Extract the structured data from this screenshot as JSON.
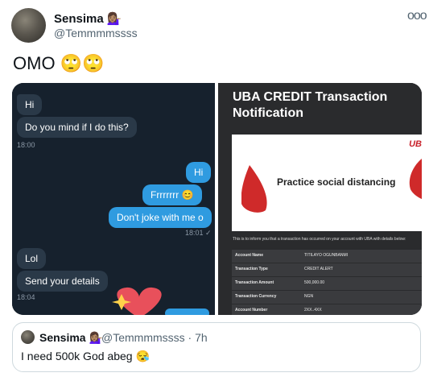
{
  "tweet": {
    "display_name": "Sensima",
    "name_emoji": "💁🏽‍♀️",
    "handle": "@Temmmmssss",
    "more_glyph": "ooo",
    "text": "OMO 🙄🙄"
  },
  "chat": {
    "messages": [
      {
        "dir": "in",
        "text": "Hi"
      },
      {
        "dir": "in",
        "text": "Do you mind if I do this?"
      },
      {
        "dir": "out",
        "text": "Hi"
      },
      {
        "dir": "out",
        "text": "Frrrrrrr 😊"
      },
      {
        "dir": "out",
        "text": "Don't joke with me o"
      },
      {
        "dir": "in",
        "text": "Lol"
      },
      {
        "dir": "in",
        "text": "Send your details"
      }
    ],
    "times": {
      "t1": "18:00",
      "t2": "18:01 ✓",
      "t3": "18:04"
    }
  },
  "uba": {
    "title": "UBA CREDIT Transaction Notification",
    "banner_text": "Practice social distancing",
    "banner_logo": "UB",
    "info_text": "This is to inform you that a transaction has occurred on your account with UBA with details below:",
    "rows": [
      {
        "label": "Account Name",
        "value": "TITILAYO OGUNBANMI"
      },
      {
        "label": "Transaction Type",
        "value": "CREDIT ALERT"
      },
      {
        "label": "Transaction Amount",
        "value": "500,000.00"
      },
      {
        "label": "Transaction Currency",
        "value": "NGN"
      },
      {
        "label": "Account Number",
        "value": "2XX..4XX"
      }
    ]
  },
  "quote": {
    "display_name": "Sensima",
    "name_emoji": "💁🏽‍♀️",
    "handle_time": "@Temmmmssss · 7h",
    "text": "I need 500k God abeg 😪"
  },
  "colors": {
    "accent_blue": "#2f9be0",
    "uba_red": "#c8202a"
  }
}
